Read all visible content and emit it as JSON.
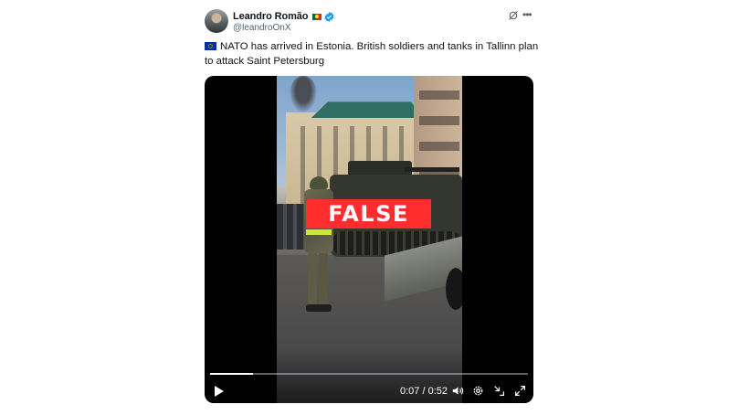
{
  "post": {
    "author_name": "Leandro Romão",
    "author_handle": "@leandroOnX",
    "text": "NATO has arrived in Estonia. British soldiers and tanks in Tallinn plan to attack Saint Petersburg",
    "icons": {
      "author_flag": "portugal-flag-icon",
      "verified": "verified-badge-icon",
      "grok": "grok-icon",
      "more": "more-icon",
      "text_flag": "eu-flag-icon"
    }
  },
  "video": {
    "overlay_label": "FALSE",
    "overlay_color": "#ff2d2d",
    "time_display": "0:07 / 0:52",
    "progress": 0.135,
    "controls": [
      "play-icon",
      "volume-icon",
      "settings-icon",
      "exit-fullscreen-icon",
      "fullscreen-icon"
    ]
  },
  "colors": {
    "text_primary": "#0f1419",
    "text_secondary": "#536471",
    "verified_blue": "#1d9bf0"
  }
}
